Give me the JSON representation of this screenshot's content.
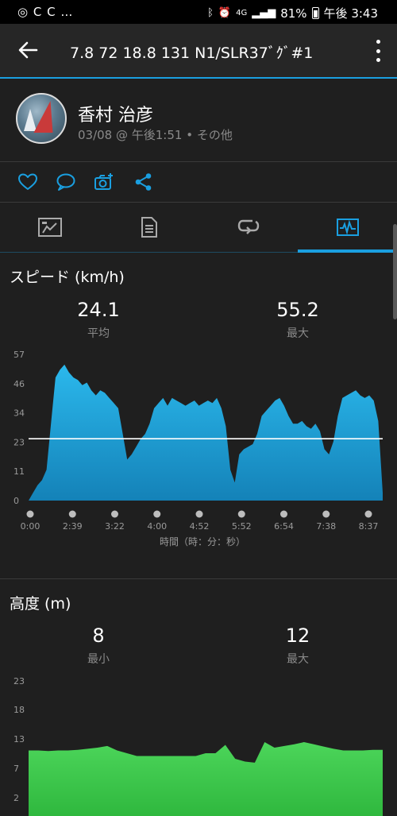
{
  "status_bar": {
    "left_icons": "◎ C C …",
    "battery": "81%",
    "time": "午後 3:43",
    "network": "4G"
  },
  "app_bar": {
    "title": "7.8   72   18.8   131   N1/SLR37ﾞｸﾞ#1"
  },
  "profile": {
    "name": "香村 治彦",
    "meta": "03/08 @ 午後1:51 • その他"
  },
  "tabs": [
    "overview-icon",
    "details-icon",
    "laps-icon",
    "charts-icon"
  ],
  "accent_color": "#1a9fe0",
  "speed_section": {
    "title": "スピード (km/h)",
    "avg_value": "24.1",
    "avg_label": "平均",
    "max_value": "55.2",
    "max_label": "最大"
  },
  "altitude_section": {
    "title": "高度 (m)",
    "min_value": "8",
    "min_label": "最小",
    "max_value": "12",
    "max_label": "最大"
  },
  "chart_data": [
    {
      "type": "area",
      "y_ticks": [
        "57",
        "46",
        "34",
        "23",
        "11",
        "0"
      ],
      "x_ticks": [
        "0:00",
        "2:39",
        "3:22",
        "4:00",
        "4:52",
        "5:52",
        "6:54",
        "7:38",
        "8:37"
      ],
      "xlabel": "時間（時：分：秒）",
      "ylim": [
        0,
        57
      ],
      "average_line": 24.1,
      "color": "#1aa7df",
      "values": [
        0,
        3,
        6,
        8,
        12,
        30,
        48,
        51,
        53,
        50,
        48,
        47,
        45,
        46,
        43,
        41,
        43,
        42,
        40,
        38,
        36,
        26,
        16,
        18,
        21,
        24,
        26,
        30,
        36,
        38,
        40,
        37,
        40,
        39,
        38,
        37,
        38,
        39,
        37,
        38,
        39,
        38,
        40,
        36,
        29,
        12,
        7,
        18,
        20,
        21,
        22,
        26,
        33,
        35,
        37,
        39,
        40,
        37,
        33,
        30,
        30,
        31,
        29,
        28,
        30,
        27,
        20,
        18,
        23,
        33,
        40,
        41,
        42,
        43,
        41,
        40,
        41,
        39,
        31,
        3
      ]
    },
    {
      "type": "area",
      "y_ticks": [
        "23",
        "18",
        "13",
        "7",
        "2"
      ],
      "ylim": [
        0,
        23
      ],
      "color": "#3fca4e",
      "values": [
        10.5,
        10.5,
        10.4,
        10.5,
        10.5,
        10.6,
        10.8,
        11,
        11.3,
        10.5,
        10,
        9.5,
        9.5,
        9.5,
        9.5,
        9.5,
        9.5,
        9.5,
        10,
        10,
        11.5,
        9,
        8.5,
        8.3,
        12,
        11,
        11.3,
        11.6,
        12,
        11.6,
        11.2,
        10.8,
        10.5,
        10.5,
        10.5,
        10.6,
        10.6
      ]
    }
  ]
}
